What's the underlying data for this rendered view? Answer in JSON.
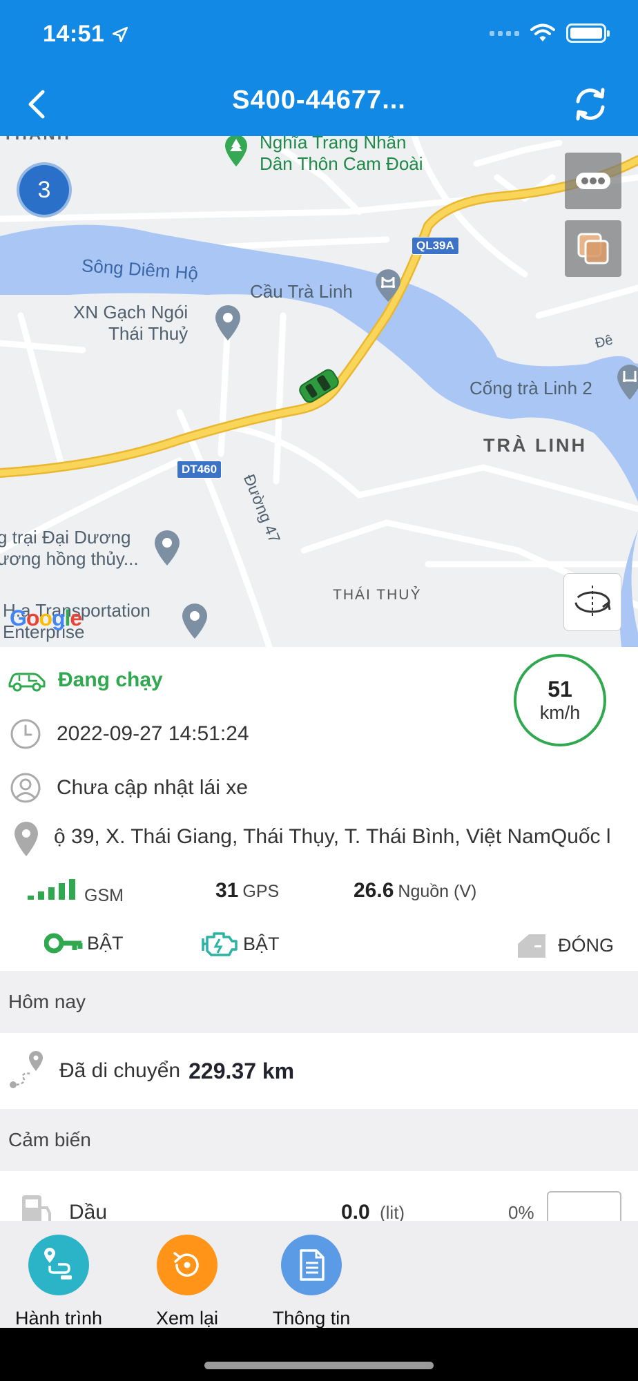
{
  "status_bar": {
    "time": "14:51"
  },
  "header": {
    "title": "S400-44677...",
    "back_icon": "chevron-left-icon",
    "refresh_icon": "refresh-icon"
  },
  "map": {
    "cluster_count": "3",
    "labels": {
      "cemetery": "Nghĩa Trang Nhân\nDân Thôn Cam Đoài",
      "river": "Sông Diêm Hộ",
      "bridge": "Cầu Trà Linh",
      "factory": "XN Gạch Ngói\nThái Thuỷ",
      "sluice": "Cống trà Linh 2",
      "commune": "TRÀ LINH",
      "road47": "Đường 47",
      "farm": "g trại Đại Dương\nương hồng thủy...",
      "transport": "H.a Transportation\nEnterprise",
      "district": "THÁI THUỶ",
      "top_left": "THANH",
      "de": "Đê"
    },
    "shields": {
      "ql39a": "QL39A",
      "dt460": "DT460"
    },
    "brand": [
      "G",
      "o",
      "o",
      "g",
      "l",
      "e"
    ]
  },
  "vehicle": {
    "status": "Đang chạy",
    "timestamp": "2022-09-27 14:51:24",
    "driver": "Chưa cập nhật lái xe",
    "address": "ộ 39, X. Thái Giang, Thái Thụy, T. Thái Bình, Việt NamQuốc l",
    "speed": "51",
    "speed_unit": "km/h"
  },
  "stats": {
    "gsm_label": "GSM",
    "gps_value": "31",
    "gps_label": "GPS",
    "power_value": "26.6",
    "power_label": "Nguồn (V)"
  },
  "flags": {
    "key": "BẬT",
    "engine": "BẬT",
    "door": "ĐÓNG"
  },
  "today": {
    "heading": "Hôm nay",
    "distance_label": "Đã di chuyển",
    "distance_value": "229.37 km"
  },
  "sensors": {
    "heading": "Cảm biến",
    "items": [
      {
        "name": "Dầu",
        "value": "0.0",
        "unit": "(lit)",
        "percent": "0%"
      }
    ]
  },
  "tabs": [
    {
      "label": "Hành trình",
      "icon": "route-icon",
      "color": "#2bb3c7"
    },
    {
      "label": "Xem lại",
      "icon": "replay-icon",
      "color": "#ff9418"
    },
    {
      "label": "Thông tin",
      "icon": "document-icon",
      "color": "#5b9be6"
    }
  ],
  "colors": {
    "header": "#1389e6",
    "running": "#2fa84f",
    "road": "#f7c843",
    "water": "#a9c6f5"
  }
}
